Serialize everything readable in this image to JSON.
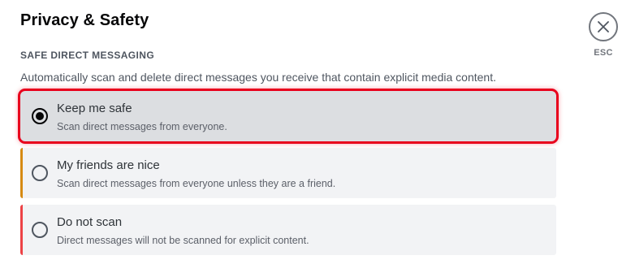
{
  "page": {
    "title": "Privacy & Safety"
  },
  "close": {
    "hint": "ESC",
    "icon": "close-icon"
  },
  "safe_dm": {
    "header": "SAFE DIRECT MESSAGING",
    "description": "Automatically scan and delete direct messages you receive that contain explicit media content.",
    "selected_index": 0,
    "options": [
      {
        "label": "Keep me safe",
        "description": "Scan direct messages from everyone.",
        "accent": "none"
      },
      {
        "label": "My friends are nice",
        "description": "Scan direct messages from everyone unless they are a friend.",
        "accent": "#d68a13"
      },
      {
        "label": "Do not scan",
        "description": "Direct messages will not be scanned for explicit content.",
        "accent": "#ed4245"
      }
    ]
  },
  "colors": {
    "highlight_outline": "#e8001c",
    "selected_bg": "#dcdee1",
    "option_bg": "#f2f3f5"
  }
}
